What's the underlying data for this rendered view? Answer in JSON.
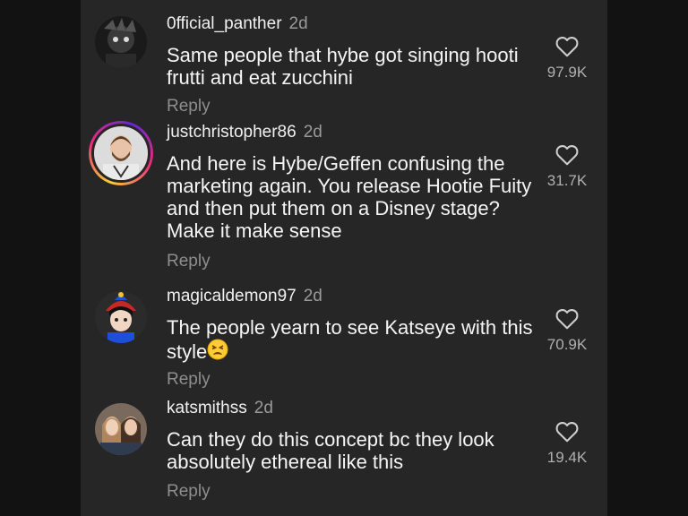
{
  "comments": [
    {
      "username": "0fficial_panther",
      "time": "2d",
      "text": "Same people that hybe got singing hooti frutti and eat zucchini",
      "likes": "97.9K",
      "reply_label": "Reply",
      "avatar": "dark-anime-avatar"
    },
    {
      "username": "justchristopher86",
      "time": "2d",
      "text": "And here is Hybe/Geffen confusing the marketing again. You release Hootie Fuity and then put them on a Disney stage? Make it make sense",
      "likes": "31.7K",
      "reply_label": "Reply",
      "avatar": "man-with-story-ring-avatar"
    },
    {
      "username": "magicaldemon97",
      "time": "2d",
      "text_main": "The people yearn to see Katseye with this style",
      "emoji": "weary-face-emoji",
      "likes": "70.9K",
      "reply_label": "Reply",
      "avatar": "jester-costume-avatar"
    },
    {
      "username": "katsmithss",
      "time": "2d",
      "text": "Can they do this concept bc they look absolutely ethereal like this",
      "likes": "19.4K",
      "reply_label": "Reply",
      "avatar": "two-people-selfie-avatar"
    }
  ],
  "icons": {
    "like": "heart-outline-icon"
  },
  "colors": {
    "panel_bg": "#262626",
    "page_bg": "#121212",
    "text_primary": "#f5f5f5",
    "text_secondary": "#8e8e8e"
  }
}
